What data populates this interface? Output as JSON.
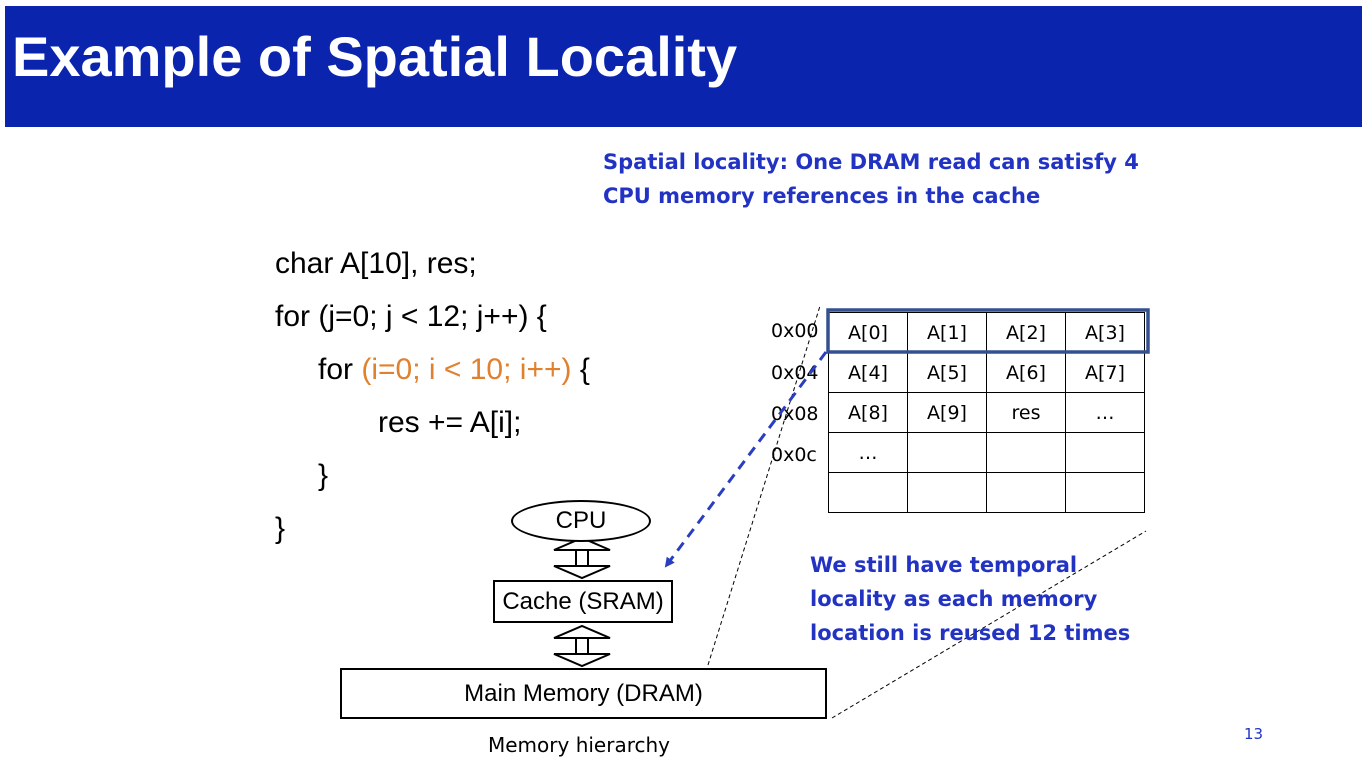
{
  "title": "Example of Spatial Locality",
  "spatial_note": {
    "line1": "Spatial locality: One DRAM read can satisfy 4",
    "line2": "CPU memory references in the cache"
  },
  "code": {
    "line1": "char A[10], res;",
    "line2": "for (j=0; j < 12; j++) {",
    "line3_kw": "for ",
    "line3_cond": "(i=0; i < 10; i++)",
    "line3_end": " {",
    "line4": "res += A[i];",
    "line5": "}",
    "line6": "}"
  },
  "memory": {
    "addresses": [
      "0x00",
      "0x04",
      "0x08",
      "0x0c"
    ],
    "rows": [
      [
        "A[0]",
        "A[1]",
        "A[2]",
        "A[3]"
      ],
      [
        "A[4]",
        "A[5]",
        "A[6]",
        "A[7]"
      ],
      [
        "A[8]",
        "A[9]",
        "res",
        "…"
      ],
      [
        "…",
        "",
        "",
        ""
      ],
      [
        "",
        "",
        "",
        ""
      ]
    ]
  },
  "hierarchy": {
    "cpu": "CPU",
    "cache": "Cache (SRAM)",
    "main_memory": "Main Memory (DRAM)",
    "caption": "Memory hierarchy"
  },
  "temporal_note": {
    "line1": "We still have temporal",
    "line2": "locality as each memory",
    "line3": "location is reused 12 times"
  },
  "page_number": "13",
  "colors": {
    "title_bar": "#0b24ad",
    "note_text": "#2233c4",
    "highlight_box": "#34508f",
    "code_highlight": "#e0812f",
    "arrow": "#2a3fc0"
  }
}
